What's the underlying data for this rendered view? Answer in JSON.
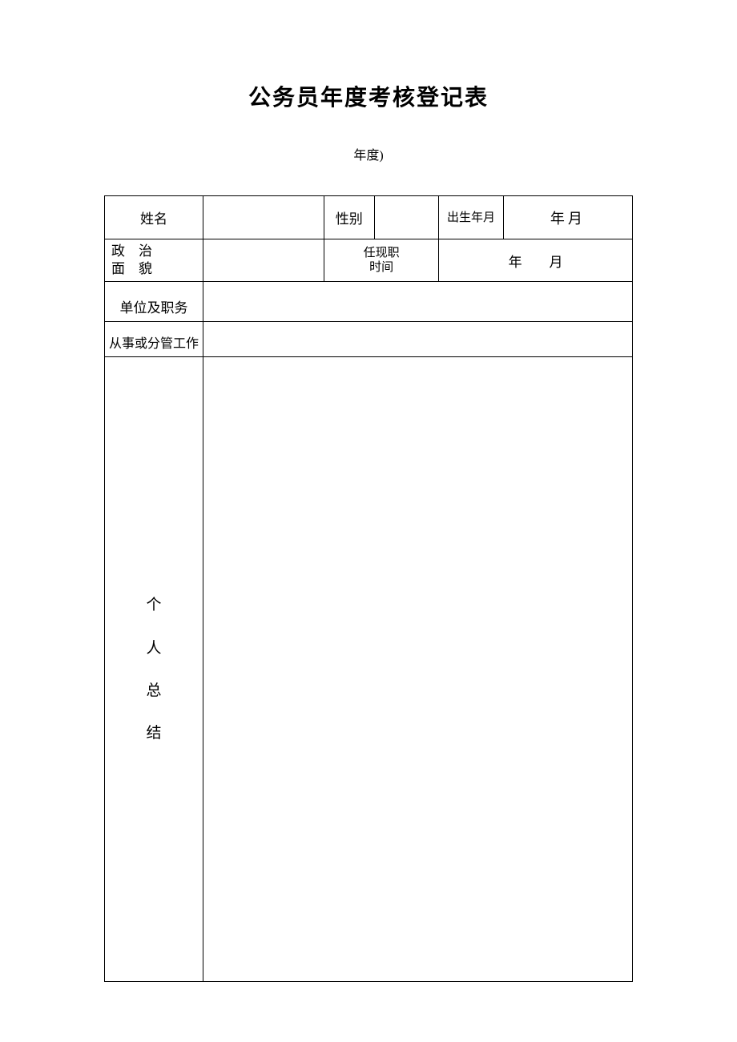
{
  "title": "公务员年度考核登记表",
  "subtitle": "年度)",
  "labels": {
    "name": "姓名",
    "gender": "性别",
    "birth": "出生年月",
    "birth_value": "年月",
    "political_line1": "政　治",
    "political_line2": "面　貌",
    "appoint_time_line1": "任现职",
    "appoint_time_line2": "时间",
    "appoint_value": "年　　月",
    "unit_position": "单位及职务",
    "work_scope": "从事或分管工作",
    "summary_char1": "个",
    "summary_char2": "人",
    "summary_char3": "总",
    "summary_char4": "结"
  }
}
